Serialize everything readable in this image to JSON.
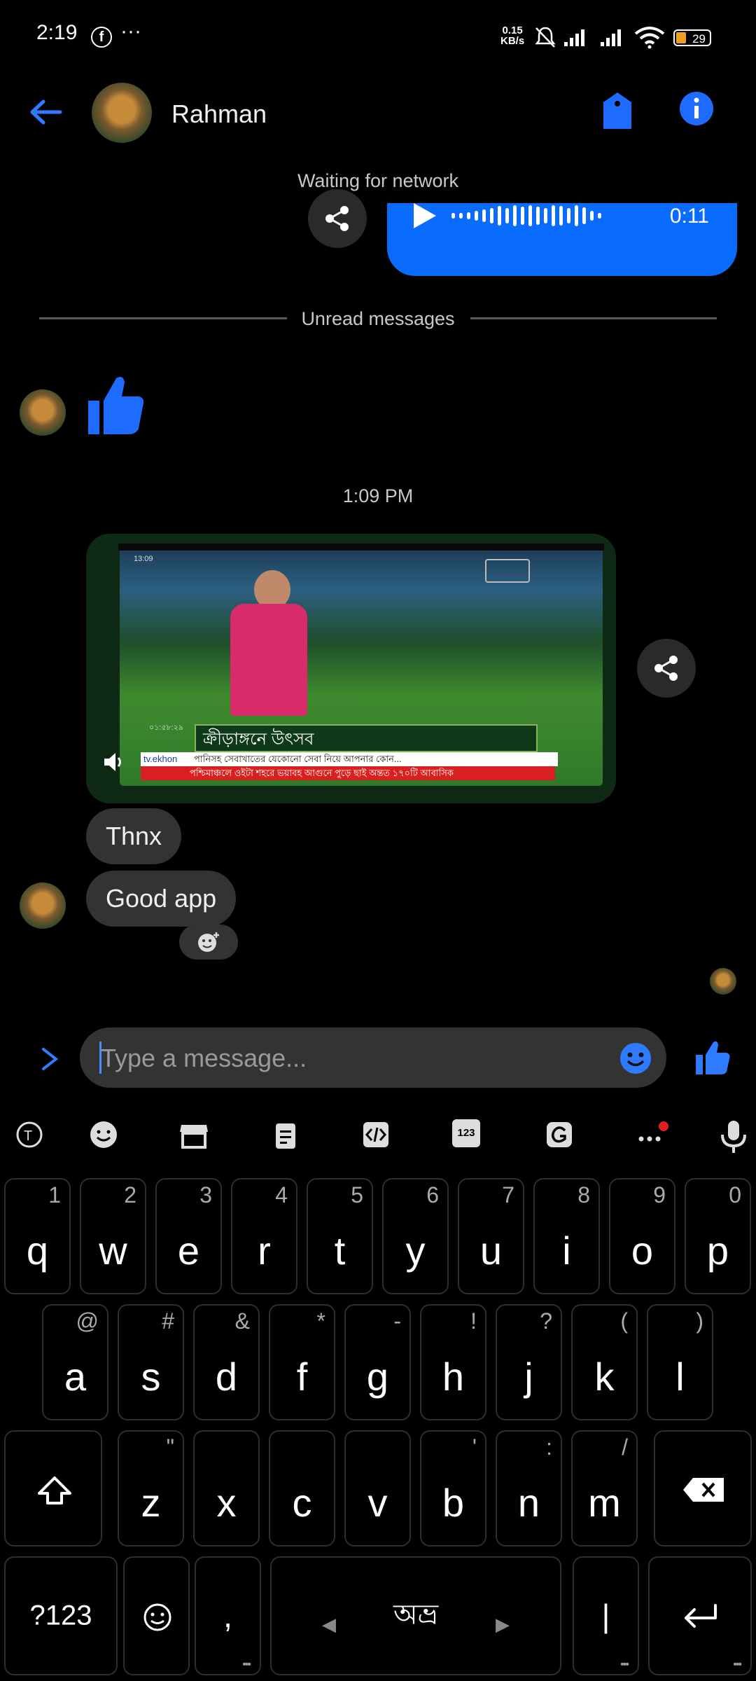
{
  "status_bar": {
    "time": "2:19",
    "fb_icon": "f",
    "more": "···",
    "net_speed_top": "0.15",
    "net_speed_bottom": "KB/s",
    "battery": "29"
  },
  "header": {
    "contact_name": "Rahman",
    "icons": [
      "back-arrow-icon",
      "tag-icon",
      "info-icon"
    ],
    "accent_color": "#0a6cff"
  },
  "network_status": "Waiting for network",
  "audio_message": {
    "duration": "0:11"
  },
  "unread_divider": "Unread messages",
  "time_separator": "1:09 PM",
  "video_message": {
    "caption_bangla": "ক্রীড়াঙ্গনে উৎসব",
    "ticker_1": "পানিসহ সেবাখাতের যেকোনো সেবা নিয়ে আপনার কোন...",
    "ticker_2": "পশ্চিমাঞ্চলে ওইটা শহরে ভয়াবহ আগুনে পুড়ে ছাই অন্তত ১৭০টি আবাসিক",
    "channel": "tv.ekhon",
    "clock": "13:09",
    "tv_time": "০১:৫৮:২৯"
  },
  "messages_in": [
    "Thnx",
    "Good app"
  ],
  "composer": {
    "placeholder": "Type a message..."
  },
  "keyboard": {
    "row1": [
      {
        "k": "q",
        "s": "1"
      },
      {
        "k": "w",
        "s": "2"
      },
      {
        "k": "e",
        "s": "3"
      },
      {
        "k": "r",
        "s": "4"
      },
      {
        "k": "t",
        "s": "5"
      },
      {
        "k": "y",
        "s": "6"
      },
      {
        "k": "u",
        "s": "7"
      },
      {
        "k": "i",
        "s": "8"
      },
      {
        "k": "o",
        "s": "9"
      },
      {
        "k": "p",
        "s": "0"
      }
    ],
    "row2": [
      {
        "k": "a",
        "s": "@"
      },
      {
        "k": "s",
        "s": "#"
      },
      {
        "k": "d",
        "s": "&"
      },
      {
        "k": "f",
        "s": "*"
      },
      {
        "k": "g",
        "s": "-"
      },
      {
        "k": "h",
        "s": "!"
      },
      {
        "k": "j",
        "s": "?"
      },
      {
        "k": "k",
        "s": "("
      },
      {
        "k": "l",
        "s": ")"
      }
    ],
    "row3": [
      {
        "k": "z",
        "s": "\""
      },
      {
        "k": "x",
        "s": ""
      },
      {
        "k": "c",
        "s": ""
      },
      {
        "k": "v",
        "s": ""
      },
      {
        "k": "b",
        "s": "'"
      },
      {
        "k": "n",
        "s": ":"
      },
      {
        "k": "m",
        "s": "/"
      }
    ],
    "symbols_key": "?123",
    "comma": ",",
    "space_label": "অভ্র",
    "period": "|",
    "toolbar_123": "123"
  }
}
